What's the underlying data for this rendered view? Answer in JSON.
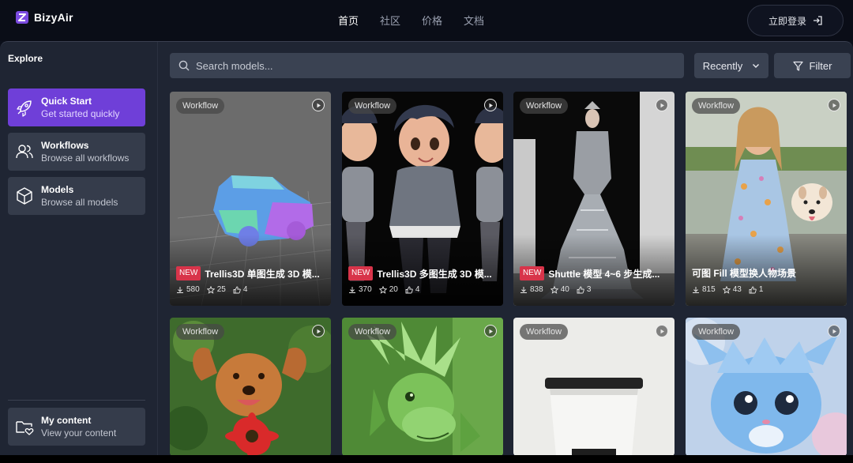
{
  "app": {
    "name": "BizyAir"
  },
  "nav": [
    {
      "label": "首页",
      "active": true
    },
    {
      "label": "社区",
      "active": false
    },
    {
      "label": "价格",
      "active": false
    },
    {
      "label": "文档",
      "active": false
    }
  ],
  "header": {
    "login_label": "立即登录"
  },
  "sidebar": {
    "title": "Explore",
    "items": [
      {
        "label": "Quick Start",
        "sub": "Get started quickly",
        "icon": "rocket-icon",
        "active": true
      },
      {
        "label": "Workflows",
        "sub": "Browse all workflows",
        "icon": "users-icon",
        "active": false
      },
      {
        "label": "Models",
        "sub": "Browse all models",
        "icon": "cube-icon",
        "active": false
      }
    ],
    "footer": {
      "label": "My content",
      "sub": "View your content",
      "icon": "folder-heart-icon"
    }
  },
  "toolbar": {
    "search_placeholder": "Search models...",
    "sort_label": "Recently",
    "filter_label": "Filter"
  },
  "cards": [
    {
      "badge": "Workflow",
      "new": true,
      "new_label": "NEW",
      "title": "Trellis3D 单图生成 3D 模...",
      "downloads": "580",
      "stars": "25",
      "likes": "4",
      "thumb": "3d-car"
    },
    {
      "badge": "Workflow",
      "new": true,
      "new_label": "NEW",
      "title": "Trellis3D 多图生成 3D 模...",
      "downloads": "370",
      "stars": "20",
      "likes": "4",
      "thumb": "cartoon-character"
    },
    {
      "badge": "Workflow",
      "new": true,
      "new_label": "NEW",
      "title": "Shuttle 模型 4~6 步生成...",
      "downloads": "838",
      "stars": "40",
      "likes": "3",
      "thumb": "silver-gown"
    },
    {
      "badge": "Workflow",
      "new": false,
      "new_label": "",
      "title": "可图 Fill 模型换人物场景",
      "downloads": "815",
      "stars": "43",
      "likes": "1",
      "thumb": "girl-with-dog"
    },
    {
      "badge": "Workflow",
      "thumb": "dog-with-flower"
    },
    {
      "badge": "Workflow",
      "thumb": "green-dragon"
    },
    {
      "badge": "Workflow",
      "thumb": "coffee-cup"
    },
    {
      "badge": "Workflow",
      "thumb": "blue-creature"
    }
  ],
  "colors": {
    "accent": "#6f3fd8",
    "new_badge": "#d8344a",
    "panel": "#1f2533",
    "topbar": "#0a0d17",
    "control": "#3a4252"
  }
}
